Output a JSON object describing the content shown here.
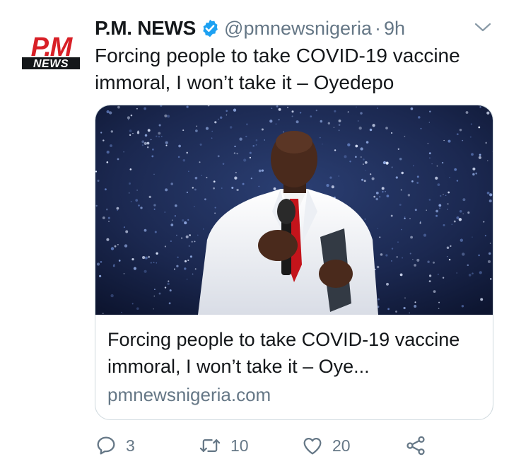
{
  "tweet": {
    "author": {
      "name": "P.M. NEWS",
      "handle": "@pmnewsnigeria",
      "separator": "·",
      "time": "9h",
      "verified": true,
      "avatar_logo": {
        "top": "P.M",
        "bottom": "NEWS"
      }
    },
    "text": "Forcing people to take COVID-19 vaccine immoral, I won’t take it – Oyedepo",
    "link_card": {
      "title": "Forcing people to take COVID-19 vaccine immoral, I won’t take it – Oye...",
      "domain": "pmnewsnigeria.com"
    },
    "actions": {
      "reply_count": "3",
      "retweet_count": "10",
      "like_count": "20"
    }
  },
  "icons": {
    "verified": "verified-badge-icon",
    "caret": "chevron-down-icon",
    "reply": "reply-icon",
    "retweet": "retweet-icon",
    "like": "heart-icon",
    "share": "share-icon"
  },
  "colors": {
    "brand_red": "#d81f26",
    "verified_blue": "#1da1f2",
    "text_primary": "#14171a",
    "text_secondary": "#657786",
    "border": "#cfd9de"
  }
}
